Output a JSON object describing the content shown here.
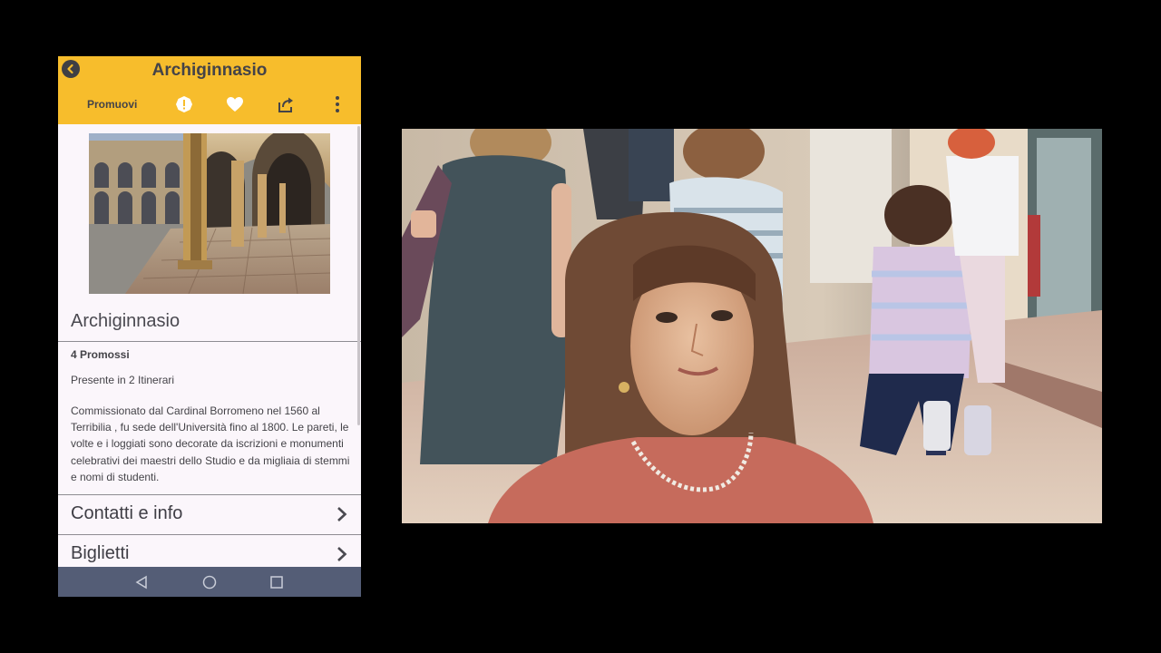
{
  "app": {
    "title": "Archiginnasio",
    "toolbar": {
      "promote_label": "Promuovi",
      "icons": [
        "alert-icon",
        "heart-icon",
        "share-icon",
        "more-vert-icon"
      ]
    }
  },
  "place": {
    "name": "Archiginnasio",
    "promoted": "4 Promossi",
    "itineraries": "Presente in 2 Itinerari",
    "description": "Commissionato dal Cardinal Borromeno nel 1560 al Terribilia , fu sede dell'Università fino al 1800. Le pareti, le volte e i loggiati sono decorate da iscrizioni e monumenti celebrativi dei maestri dello Studio e da migliaia di stemmi e nomi di studenti."
  },
  "rows": [
    {
      "label": "Contatti e info"
    },
    {
      "label": "Biglietti"
    }
  ],
  "colors": {
    "appbar": "#f7bd2c",
    "background": "#fbf6fb",
    "navbar": "#545d76",
    "text": "#444348"
  }
}
